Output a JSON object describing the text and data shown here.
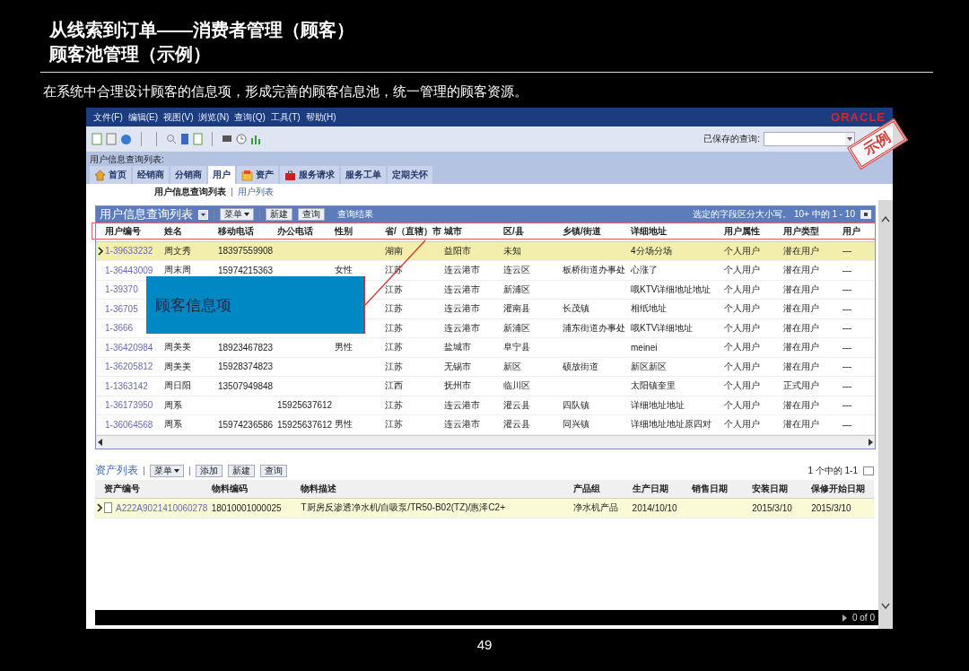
{
  "slide": {
    "title_lines": [
      "从线索到订单——消费者管理（顾客）",
      "顾客池管理（示例）"
    ],
    "subtitle": "在系统中合理设计顾客的信息项，形成完善的顾客信息池，统一管理的顾客资源。",
    "page_number": "49"
  },
  "app": {
    "menu": [
      "文件(F)",
      "编辑(E)",
      "视图(V)",
      "浏览(N)",
      "查询(Q)",
      "工具(T)",
      "帮助(H)"
    ],
    "brand": "ORACLE",
    "saved_query_label": "已保存的查询:",
    "breadcrumb": "用户信息查询列表:",
    "tabs": [
      {
        "label": "首页",
        "selected": false,
        "kind": "home"
      },
      {
        "label": "经销商",
        "selected": false,
        "kind": "plain"
      },
      {
        "label": "分销商",
        "selected": false,
        "kind": "plain"
      },
      {
        "label": "用户",
        "selected": true,
        "kind": "plain"
      },
      {
        "label": "资产",
        "selected": false,
        "kind": "asset"
      },
      {
        "label": "服务请求",
        "selected": false,
        "kind": "service"
      },
      {
        "label": "服务工单",
        "selected": false,
        "kind": "plain"
      },
      {
        "label": "定期关怀",
        "selected": false,
        "kind": "plain"
      }
    ],
    "subviews": [
      {
        "label": "用户信息查询列表",
        "selected": true
      },
      {
        "label": "用户列表",
        "selected": false
      }
    ],
    "user_list": {
      "title": "用户信息查询列表",
      "toolbar": [
        {
          "label": "菜单",
          "kind": "menu"
        },
        {
          "label": "新建",
          "kind": "button"
        },
        {
          "label": "查询",
          "kind": "button"
        }
      ],
      "results_label": "查询结果",
      "status": "选定的字段区分大小写。 10+ 中的 1 - 10",
      "columns": [
        "用户编号",
        "姓名",
        "移动电话",
        "办公电话",
        "性别",
        "省/（直辖）市",
        "城市",
        "区/县",
        "乡镇/街道",
        "详细地址",
        "用户属性",
        "用户类型",
        "用户"
      ],
      "rows": [
        {
          "selected": true,
          "cells": [
            "1-39633232",
            "周文秀",
            "18397559908",
            null,
            null,
            "湖南",
            "益阳市",
            "未知",
            null,
            "4分场分场",
            "个人用户",
            "潜在用户",
            "—"
          ]
        },
        {
          "selected": false,
          "cells": [
            "1-36443009",
            "周末周",
            "15974215363",
            null,
            "女性",
            "江苏",
            "连云港市",
            "连云区",
            "板桥街道办事处",
            "心涨了",
            "个人用户",
            "潜在用户",
            "—"
          ]
        },
        {
          "selected": false,
          "cells": [
            "1-39370",
            null,
            null,
            null,
            null,
            "江苏",
            "连云港市",
            "新浦区",
            null,
            "哦KTV详细地址地址",
            "个人用户",
            "潜在用户",
            "—"
          ]
        },
        {
          "selected": false,
          "cells": [
            "1-36705",
            null,
            null,
            null,
            null,
            "江苏",
            "连云港市",
            "灌南县",
            "长茂镇",
            "相纸地址",
            "个人用户",
            "潜在用户",
            "—"
          ]
        },
        {
          "selected": false,
          "cells": [
            "1-3666",
            null,
            null,
            null,
            null,
            "江苏",
            "连云港市",
            "新浦区",
            "浦东街道办事处",
            "哦KTV详细地址",
            "个人用户",
            "潜在用户",
            "—"
          ]
        },
        {
          "selected": false,
          "cells": [
            "1-36420984",
            "周美美",
            "18923467823",
            null,
            "男性",
            "江苏",
            "盐城市",
            "阜宁县",
            null,
            "meinei",
            "个人用户",
            "潜在用户",
            "—"
          ]
        },
        {
          "selected": false,
          "cells": [
            "1-36205812",
            "周美美",
            "15928374823",
            null,
            null,
            "江苏",
            "无锡市",
            "新区",
            "硕放街道",
            "新区新区",
            "个人用户",
            "潜在用户",
            "—"
          ]
        },
        {
          "selected": false,
          "cells": [
            "1-1363142",
            "周日阳",
            "13507949848",
            null,
            null,
            "江西",
            "抚州市",
            "临川区",
            null,
            "太阳镇奎里",
            "个人用户",
            "正式用户",
            "—"
          ]
        },
        {
          "selected": false,
          "cells": [
            "1-36173950",
            "周系",
            null,
            "15925637612",
            null,
            "江苏",
            "连云港市",
            "灌云县",
            "四队镇",
            "详细地址地址",
            "个人用户",
            "潜在用户",
            "—"
          ]
        },
        {
          "selected": false,
          "cells": [
            "1-36064568",
            "周系",
            "15974236586",
            "15925637612",
            "男性",
            "江苏",
            "连云港市",
            "灌云县",
            "同兴镇",
            "详细地址地址原四对",
            "个人用户",
            "潜在用户",
            "—"
          ]
        }
      ]
    },
    "asset_list": {
      "title": "资产列表",
      "toolbar": [
        {
          "label": "菜单",
          "kind": "menu"
        },
        {
          "label": "添加",
          "kind": "button"
        },
        {
          "label": "新建",
          "kind": "button"
        },
        {
          "label": "查询",
          "kind": "button"
        }
      ],
      "status": "1 个中的 1-1",
      "columns": [
        "资产编号",
        "物料编码",
        "物料描述",
        "产品组",
        "生产日期",
        "销售日期",
        "安装日期",
        "保修开始日期"
      ],
      "rows": [
        {
          "selected": true,
          "cells": [
            "A222A9021410060278",
            "18010001000025",
            "T厨房反渗透净水机/自吸泵/TR50-B02(TZ)/惠泽C2+",
            "净水机产品",
            "2014/10/10",
            null,
            "2015/3/10",
            "2015/3/10"
          ]
        }
      ]
    },
    "pager": "0 of 0"
  },
  "annotations": {
    "callout": "顾客信息项",
    "stamp": "示例"
  }
}
